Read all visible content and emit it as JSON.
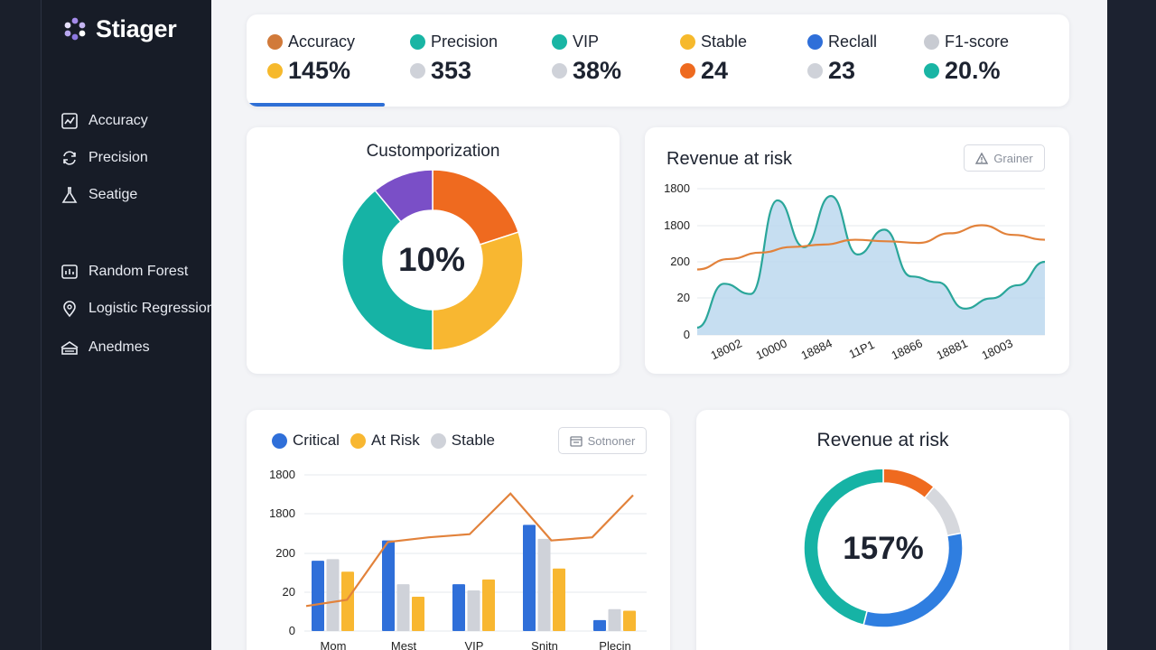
{
  "app": {
    "brand": "Stiager"
  },
  "sidebar": {
    "items": [
      {
        "label": "Accuracy",
        "icon": "chart-box-icon"
      },
      {
        "label": "Precision",
        "icon": "refresh-arrows-icon"
      },
      {
        "label": "Seatige",
        "icon": "flask-icon"
      },
      {
        "label": "Random Forest",
        "icon": "tree-box-icon"
      },
      {
        "label": "Logistic Regression",
        "icon": "map-pin-icon"
      },
      {
        "label": "Anedmes",
        "icon": "layers-icon"
      }
    ]
  },
  "kpis": [
    {
      "label": "Accuracy",
      "label_color": "#d17a3a",
      "value": "145%",
      "value_color": "#f6b92c"
    },
    {
      "label": "Precision",
      "label_color": "#19b5a4",
      "value": "353",
      "value_color": "#cfd2d9"
    },
    {
      "label": "VIP",
      "label_color": "#19b5a4",
      "value": "38%",
      "value_color": "#cfd2d9"
    },
    {
      "label": "Stable",
      "label_color": "#f6b92c",
      "value": "24",
      "value_color": "#ee6a1f"
    },
    {
      "label": "Reclall",
      "label_color": "#2f6fd9",
      "value": "23",
      "value_color": "#cfd2d9"
    },
    {
      "label": "F1-score",
      "label_color": "#c8cbd2",
      "value": "20.%",
      "value_color": "#19b5a4"
    }
  ],
  "donut1": {
    "title": "Customporization",
    "center": "10%",
    "segments": [
      {
        "value": 20,
        "color": "#ef6a1f"
      },
      {
        "value": 30,
        "color": "#f8b731"
      },
      {
        "value": 39,
        "color": "#16b3a5"
      },
      {
        "value": 11,
        "color": "#7a4fc7"
      }
    ]
  },
  "line_panel": {
    "title": "Revenue at risk",
    "button_label": "Grainer",
    "button_icon": "warning-icon"
  },
  "bar_panel": {
    "button_label": "Sotnoner",
    "button_icon": "calendar-icon"
  },
  "donut2": {
    "title": "Revenue at risk",
    "center": "157%",
    "segments": [
      {
        "value": 11,
        "color": "#ef6a1f"
      },
      {
        "value": 11,
        "color": "#d6d8dd"
      },
      {
        "value": 32,
        "color": "#2f7ee0"
      },
      {
        "value": 46,
        "color": "#16b3a5"
      }
    ]
  },
  "chart_data": [
    {
      "type": "area",
      "title": "Revenue at risk",
      "y_ticks": [
        "0",
        "20",
        "200",
        "1800",
        "1800"
      ],
      "x_ticks": [
        "18002",
        "10000",
        "18884",
        "11P1",
        "18866",
        "18881",
        "18003"
      ],
      "series": [
        {
          "color": "#2aa69a",
          "fill": "#bcd8ee",
          "values": [
            0.05,
            0.35,
            0.28,
            0.92,
            0.6,
            0.95,
            0.55,
            0.72,
            0.4,
            0.36,
            0.18,
            0.25,
            0.34,
            0.5
          ]
        },
        {
          "color": "#e2823b",
          "values": [
            0.45,
            0.58,
            0.66,
            0.73,
            0.76,
            0.82,
            0.8,
            0.78,
            0.9,
            1.0,
            0.88,
            0.82
          ]
        }
      ]
    },
    {
      "type": "bar",
      "categories": [
        "Mom",
        "Mest",
        "VIP",
        "Snitn",
        "Plecin"
      ],
      "y_ticks": [
        "0",
        "20",
        "200",
        "1800",
        "1800"
      ],
      "series": [
        {
          "name": "Critical",
          "color": "#2f6fd9",
          "values": [
            0.45,
            0.58,
            0.3,
            0.68,
            0.07
          ]
        },
        {
          "name": "Stable",
          "color": "#cfd2d9",
          "values": [
            0.46,
            0.3,
            0.26,
            0.59,
            0.14
          ]
        },
        {
          "name": "At Risk",
          "color": "#f8b731",
          "values": [
            0.38,
            0.22,
            0.33,
            0.4,
            0.13
          ]
        }
      ],
      "line": {
        "color": "#e2823b",
        "values": [
          0.16,
          0.2,
          0.57,
          0.6,
          0.62,
          0.88,
          0.58,
          0.6,
          0.87
        ]
      },
      "legend": [
        "Critical",
        "At Risk",
        "Stable"
      ]
    }
  ]
}
